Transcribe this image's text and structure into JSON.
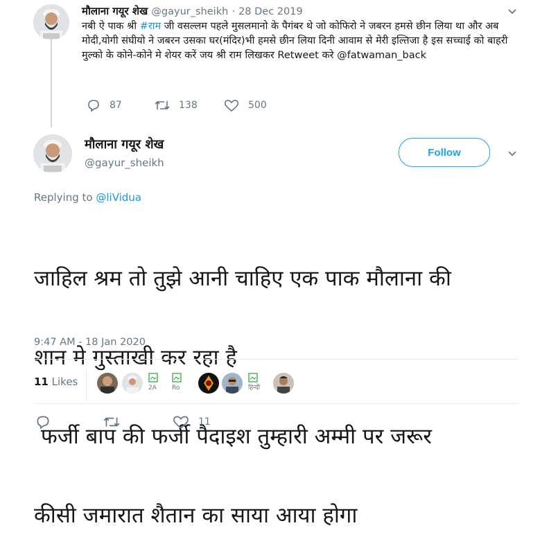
{
  "parent_tweet": {
    "author_name": "मौलाना गयूर शेख",
    "handle": "@gayur_sheikh",
    "separator": "·",
    "date": "28 Dec 2019",
    "text_before_tag": "नबी ऐ पाक श्री ",
    "hashtag": "#राम",
    "text_after_tag": " जी वसल्लम पहले मुसलमानो के पैगंबर थे जो कोफिरो ने जबरन  हमसे छीन लिया था और अब मोदी,योगी संघीयो ने जबरन उसका घर(मंदिर)भी हमसे छीन लिया दिनी आवाम से मेरी इल्तिजा है इस सच्चाई को बाहरी मुल्को के कोने-कोने मे शेयर करें जय श्री राम लिखकर Retweet करे @fatwaman_back",
    "replies": "87",
    "retweets": "138",
    "likes": "500"
  },
  "main_tweet": {
    "author_name": "मौलाना गयूर शेख",
    "handle": "@gayur_sheikh",
    "follow_label": "Follow",
    "replying_to_label": "Replying to",
    "replying_to_handle": "@liVidua",
    "text_line1": "जाहिल श्रम तो तुझे आनी चाहिए एक पाक मौलाना की",
    "text_line2": "शान मे गुस्ताखी कर रहा है",
    "text_line3": " फर्जी बाप की फर्जी पैदाइश तुम्हारी अम्मी पर जरूर",
    "text_line4": "कीसी जमारात शैतान का साया आया होगा",
    "timestamp": "9:47 AM - 18 Jan 2020",
    "likes_count": "11",
    "likes_label": "Likes",
    "broken_avatar_texts": [
      "2A",
      "Ro",
      "हिन्दी",
      ""
    ],
    "bottom_likes": "11"
  },
  "colors": {
    "accent": "#1da1f2",
    "link": "#1b95e0",
    "muted": "#657786"
  }
}
